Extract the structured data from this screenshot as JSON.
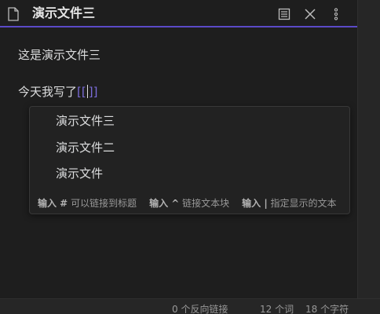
{
  "header": {
    "title": "演示文件三",
    "icons": {
      "file": "file-icon",
      "reading": "reading-view-icon",
      "close": "close-icon",
      "more": "more-vertical-icon"
    }
  },
  "editor": {
    "line1": "这是演示文件三",
    "line2_text": "今天我写了",
    "line2_open": "[[",
    "line2_close": "]]"
  },
  "suggestions": {
    "items": [
      "演示文件三",
      "演示文件二",
      "演示文件"
    ],
    "hints": [
      {
        "key": "输入 #",
        "desc": "可以链接到标题"
      },
      {
        "key": "输入 ^",
        "desc": "链接文本块"
      },
      {
        "key": "输入 |",
        "desc": "指定显示的文本"
      }
    ]
  },
  "status_bar": {
    "backlinks": "0 个反向链接",
    "words": "12 个词",
    "chars": "18 个字符"
  },
  "colors": {
    "accent": "#5b4ac7",
    "bracket": "#7b6cd9",
    "background": "#1e1e1e"
  }
}
